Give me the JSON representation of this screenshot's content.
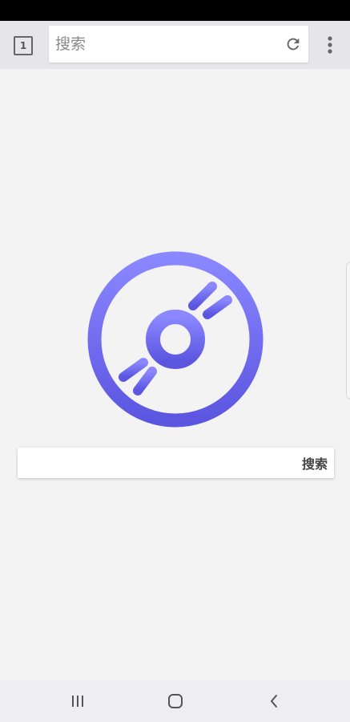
{
  "toolbar": {
    "tab_count": "1",
    "search_placeholder": "搜索",
    "reload_icon": "reload-icon",
    "menu_icon": "more-vert-icon"
  },
  "main": {
    "logo_icon": "disc-icon",
    "logo_gradient": [
      "#8b87ff",
      "#5b55e0"
    ],
    "search_value": "",
    "search_button_label": "搜索"
  },
  "nav": {
    "recents_icon": "recent-apps-icon",
    "home_icon": "home-icon",
    "back_icon": "back-icon"
  }
}
